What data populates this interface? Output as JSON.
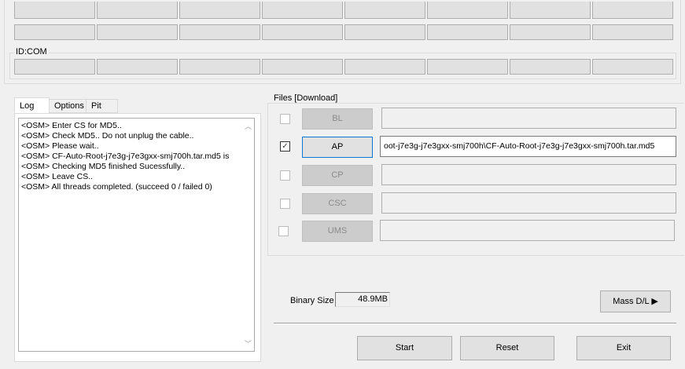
{
  "com_section": {
    "label": "ID:COM"
  },
  "tabs": [
    {
      "label": "Log",
      "active": true
    },
    {
      "label": "Options",
      "active": false
    },
    {
      "label": "Pit",
      "active": false
    }
  ],
  "log": {
    "lines": [
      "<OSM> Enter CS for MD5..",
      "<OSM> Check MD5.. Do not unplug the cable..",
      "<OSM> Please wait..",
      "<OSM> CF-Auto-Root-j7e3g-j7e3gxx-smj700h.tar.md5 is",
      "<OSM> Checking MD5 finished Sucessfully..",
      "<OSM> Leave CS..",
      "<OSM> All threads completed. (succeed 0 / failed 0)"
    ]
  },
  "files": {
    "title": "Files [Download]",
    "rows": [
      {
        "label": "BL",
        "checked": false,
        "path": "",
        "enabled": false
      },
      {
        "label": "AP",
        "checked": true,
        "path": "oot-j7e3g-j7e3gxx-smj700h\\CF-Auto-Root-j7e3g-j7e3gxx-smj700h.tar.md5",
        "enabled": true
      },
      {
        "label": "CP",
        "checked": false,
        "path": "",
        "enabled": false
      },
      {
        "label": "CSC",
        "checked": false,
        "path": "",
        "enabled": false
      },
      {
        "label": "UMS",
        "checked": false,
        "path": "",
        "enabled": false
      }
    ]
  },
  "binary": {
    "label": "Binary Size",
    "value": "48.9MB"
  },
  "buttons": {
    "mass_dl": "Mass D/L ▶",
    "start": "Start",
    "reset": "Reset",
    "exit": "Exit"
  },
  "colors": {
    "window_bg": "#f0f0f0",
    "button_bg": "#e1e1e1",
    "focus_border": "#0078d7"
  }
}
